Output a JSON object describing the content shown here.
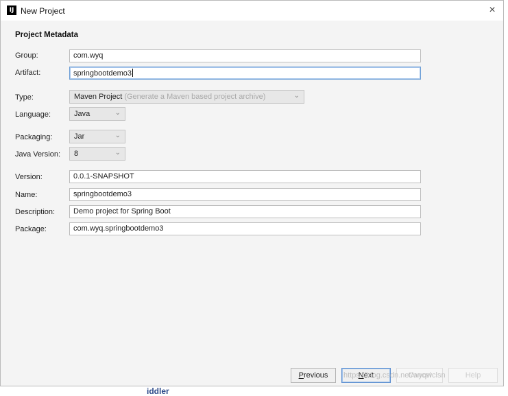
{
  "window": {
    "title": "New Project",
    "close_glyph": "×",
    "app_icon_text": "IJ"
  },
  "section_title": "Project Metadata",
  "fields": {
    "group": {
      "label": "Group:",
      "value": "com.wyq"
    },
    "artifact": {
      "label": "Artifact:",
      "value": "springbootdemo3"
    },
    "type": {
      "label": "Type:",
      "value": "Maven Project",
      "hint": "(Generate a Maven based project archive)"
    },
    "language": {
      "label": "Language:",
      "value": "Java"
    },
    "packaging": {
      "label": "Packaging:",
      "value": "Jar"
    },
    "java_version": {
      "label": "Java Version:",
      "value": "8"
    },
    "version": {
      "label": "Version:",
      "value": "0.0.1-SNAPSHOT"
    },
    "name": {
      "label": "Name:",
      "value": "springbootdemo3"
    },
    "description": {
      "label": "Description:",
      "value": "Demo project for Spring Boot"
    },
    "package": {
      "label": "Package:",
      "value": "com.wyq.springbootdemo3"
    }
  },
  "buttons": {
    "previous": {
      "mnemonic": "P",
      "rest": "revious"
    },
    "next": {
      "mnemonic": "N",
      "rest": "ext"
    },
    "cancel": "Cancel",
    "help": "Help"
  },
  "watermark": "https://blog.csdn.net/wyqwclsn",
  "background_text": "iddler"
}
